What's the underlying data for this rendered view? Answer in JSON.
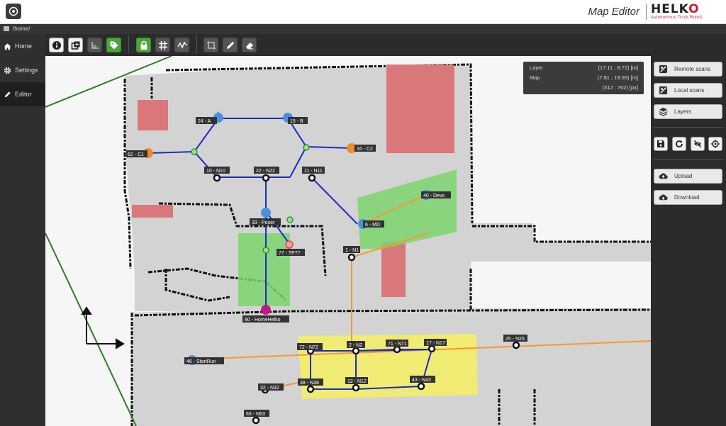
{
  "header": {
    "app_title": "Map Editor",
    "brand_name": "HELKO",
    "brand_tagline": "Autonomous Truck Robot"
  },
  "path": "/home/",
  "sidebar": {
    "items": [
      {
        "label": "Home",
        "icon": "home-icon"
      },
      {
        "label": "Settings",
        "icon": "gear-icon"
      },
      {
        "label": "Editor",
        "icon": "pencil-icon",
        "active": true
      }
    ]
  },
  "toolbar": {
    "tools": [
      "info-icon",
      "layers-copy-icon",
      "axis-icon",
      "tag-icon",
      "lock-icon",
      "grid-icon",
      "path-icon",
      "crop-icon",
      "pencil-icon",
      "eraser-icon"
    ]
  },
  "info": {
    "layer_label": "Layer",
    "layer_value": "(17.11 ; 8.72) [m]",
    "map_label": "Map",
    "map_value": "(7.81 ; 19.05) [m]",
    "px_value": "(312 ; 762) [px]"
  },
  "right_panel": {
    "remote_scans": "Remote scans",
    "local_scans": "Local scans",
    "layers": "Layers",
    "upload": "Upload",
    "download": "Download"
  },
  "colors": {
    "accent_green": "#4ca43a",
    "route_blue": "#1a2cc8",
    "route_orange": "#f59a2c",
    "zone_red": "#d9777a",
    "zone_green": "#7ed36f",
    "zone_yellow": "#f4ee62"
  },
  "nodes": {
    "n24": "24 - A",
    "n15": "15 - B",
    "n62": "62 - C1",
    "n16": "16 - C2",
    "n10": "10 - N10",
    "n22": "22 - N22",
    "n11": "11 - N11",
    "n40": "40 - Devs",
    "n33": "33 - Poser",
    "n6": "6 - MD",
    "n1": "1 - N1",
    "n77": "77 - TP77",
    "n80": "80 - HomeHelko",
    "n72": "72 - N72",
    "n2": "2 - N2",
    "n71": "71 - N71",
    "n17": "17 - N17",
    "n25": "25 - N25",
    "n46": "46 - StartRun",
    "n38": "38 - N38",
    "n12": "12 - N12",
    "n43": "43 - N43",
    "n32": "32 - N32",
    "n63": "63 - N63"
  }
}
